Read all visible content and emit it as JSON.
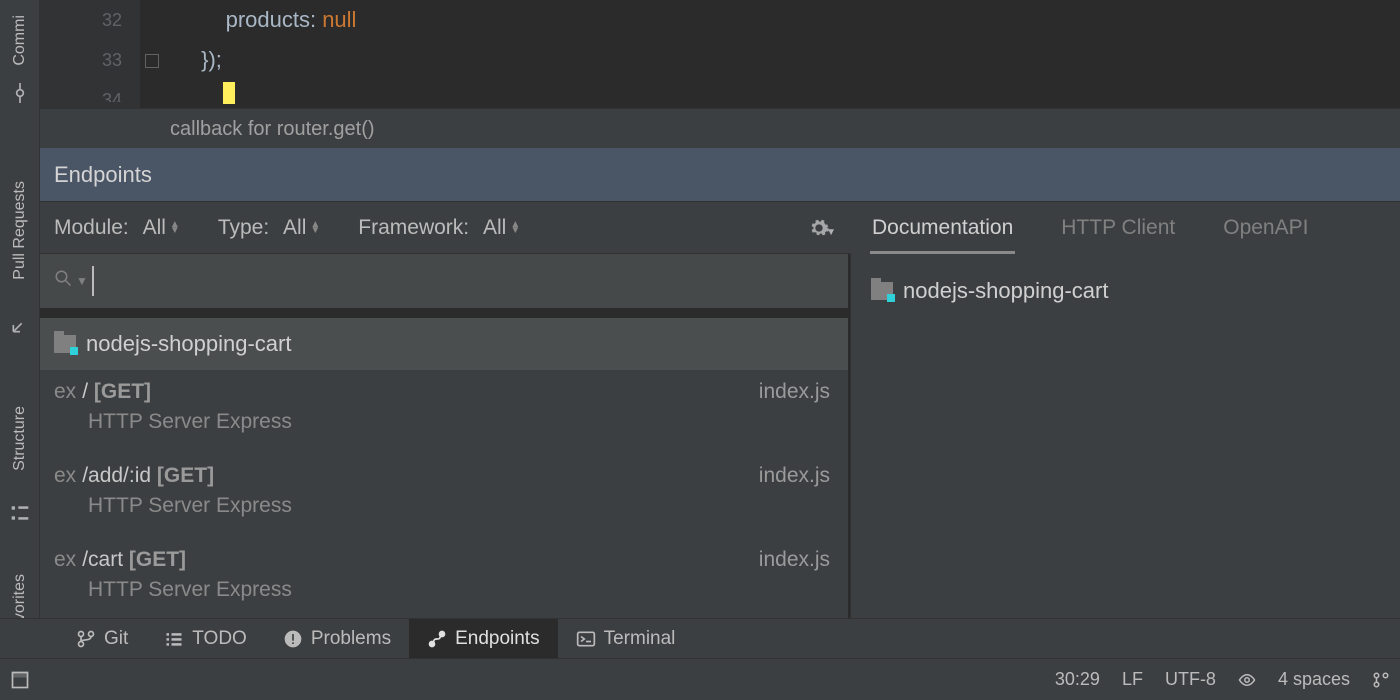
{
  "editor": {
    "lines": [
      {
        "num": "32",
        "indent": "              ",
        "text_a": "products: ",
        "null_kw": "null"
      },
      {
        "num": "33",
        "indent": "          ",
        "text_a": "});",
        "null_kw": ""
      }
    ],
    "partial_num": "34"
  },
  "breadcrumb": {
    "text": "callback for router.get()"
  },
  "endpoints_panel": {
    "title": "Endpoints",
    "filters": {
      "module": {
        "label": "Module:",
        "value": "All"
      },
      "type": {
        "label": "Type:",
        "value": "All"
      },
      "framework": {
        "label": "Framework:",
        "value": "All"
      }
    },
    "search_placeholder": "",
    "project_name": "nodejs-shopping-cart",
    "items": [
      {
        "prefix": "ex",
        "path": "/",
        "method": "[GET]",
        "file": "index.js",
        "servers": "HTTP Server   Express"
      },
      {
        "prefix": "ex",
        "path": "/add/:id",
        "method": "[GET]",
        "file": "index.js",
        "servers": "HTTP Server   Express"
      },
      {
        "prefix": "ex",
        "path": "/cart",
        "method": "[GET]",
        "file": "index.js",
        "servers": "HTTP Server   Express"
      }
    ]
  },
  "right_tabs": {
    "documentation": "Documentation",
    "http_client": "HTTP Client",
    "openapi": "OpenAPI"
  },
  "left_tool_tabs": {
    "commit": "Commi",
    "pull_requests": "Pull Requests",
    "structure": "Structure",
    "favorites": "vorites"
  },
  "bottom_tools": {
    "git": "Git",
    "todo": "TODO",
    "problems": "Problems",
    "endpoints": "Endpoints",
    "terminal": "Terminal"
  },
  "status": {
    "caret": "30:29",
    "line_sep": "LF",
    "encoding": "UTF-8",
    "indent": "4 spaces"
  }
}
